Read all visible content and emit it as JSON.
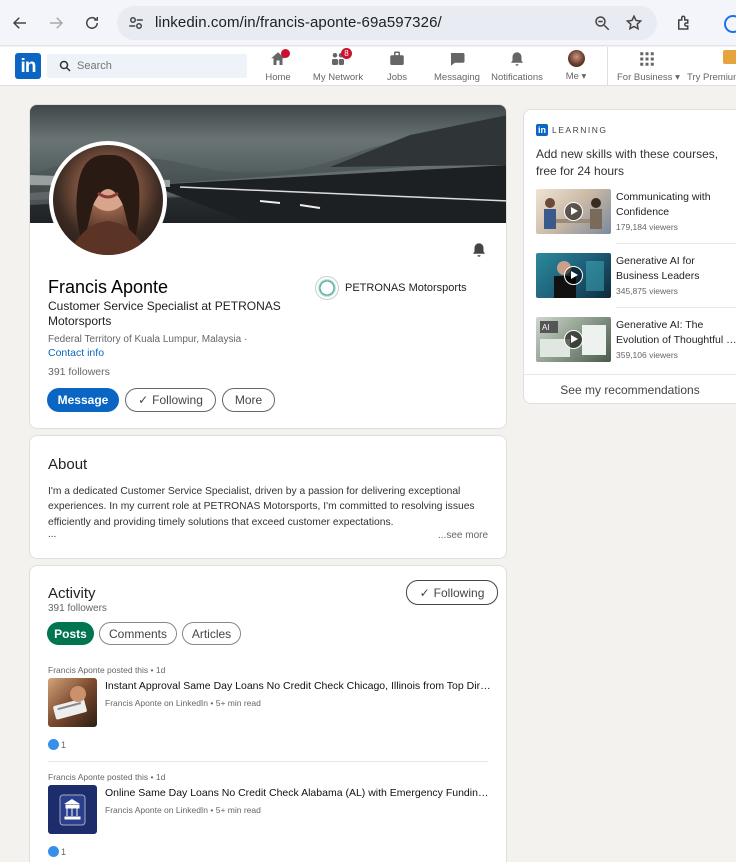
{
  "browser": {
    "url": "linkedin.com/in/francis-aponte-69a597326/"
  },
  "nav": {
    "logo": "in",
    "search_placeholder": "Search",
    "items": [
      {
        "label": "Home",
        "icon": "home-icon",
        "badge": ""
      },
      {
        "label": "My Network",
        "icon": "network-icon",
        "badge": "8"
      },
      {
        "label": "Jobs",
        "icon": "briefcase-icon",
        "badge": ""
      },
      {
        "label": "Messaging",
        "icon": "message-icon",
        "badge": ""
      },
      {
        "label": "Notifications",
        "icon": "bell-icon",
        "badge": ""
      },
      {
        "label": "Me",
        "icon": "avatar",
        "badge": ""
      },
      {
        "label": "For Business",
        "icon": "grid-icon",
        "badge": ""
      },
      {
        "label": "Try Premium",
        "icon": "premium-icon",
        "badge": ""
      }
    ]
  },
  "profile": {
    "name": "Francis Aponte",
    "headline": "Customer Service Specialist at PETRONAS Motorsports",
    "location": "Federal Territory of Kuala Lumpur, Malaysia ·",
    "contact_info": "Contact info",
    "followers": "391 followers",
    "company": "PETRONAS Motorsports",
    "buttons": {
      "message": "Message",
      "following": "Following",
      "more": "More"
    }
  },
  "about": {
    "title": "About",
    "text": "I'm a dedicated Customer Service Specialist, driven by a passion for delivering exceptional experiences. In my current role at PETRONAS Motorsports, I'm committed to resolving issues efficiently and providing timely solutions that exceed customer expectations.",
    "ellipsis": "...",
    "see_more": "...see more"
  },
  "activity": {
    "title": "Activity",
    "followers": "391 followers",
    "following_btn": "Following",
    "tabs": [
      "Posts",
      "Comments",
      "Articles"
    ],
    "posts": [
      {
        "meta": "Francis Aponte posted this • 1d",
        "title": "Instant Approval Same Day Loans No Credit Check Chicago, Illinois from Top Direct Lenders",
        "sub": "Francis Aponte on LinkedIn • 5+ min read",
        "reactions": "1"
      },
      {
        "meta": "Francis Aponte posted this • 1d",
        "title": "Online Same Day Loans No Credit Check Alabama (AL) with Emergency Funding Options",
        "sub": "Francis Aponte on LinkedIn • 5+ min read",
        "reactions": "1"
      }
    ]
  },
  "learning": {
    "label": "LEARNING",
    "intro": "Add new skills with these courses, free for 24 hours",
    "courses": [
      {
        "title_line1": "Communicating with",
        "title_line2": "Confidence",
        "views": "179,184 viewers"
      },
      {
        "title_line1": "Generative AI for",
        "title_line2": "Business Leaders",
        "views": "345,875 viewers"
      },
      {
        "title_line1": "Generative AI: The",
        "title_line2": "Evolution of Thoughtful Online Search",
        "views": "359,106 viewers"
      }
    ],
    "see_recommendations": "See my recommendations"
  }
}
